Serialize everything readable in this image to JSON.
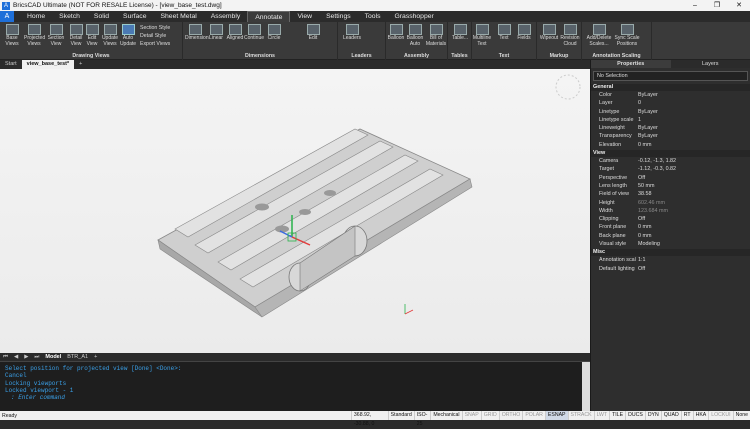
{
  "title": "BricsCAD Ultimate (NOT FOR RESALE License) - [view_base_test.dwg]",
  "menu": [
    "Home",
    "Sketch",
    "Solid",
    "Surface",
    "Sheet Metal",
    "Assembly",
    "Annotate",
    "View",
    "Settings",
    "Tools",
    "Grasshopper"
  ],
  "active_menu": "Annotate",
  "ribbon": {
    "drawing_views": {
      "title": "Drawing Views",
      "buttons": [
        "Base Views",
        "Projected Views",
        "Section View",
        "Detail View",
        "Edit View",
        "Update Views",
        "Auto Update"
      ],
      "small": [
        "Section Style",
        "Detail Style",
        "Export Views"
      ]
    },
    "dimensions": {
      "title": "Dimensions",
      "buttons": [
        "Dimension",
        "Linear",
        "Aligned",
        "Continue",
        "Circle",
        "Edit"
      ]
    },
    "leaders": {
      "title": "Leaders",
      "buttons": [
        "Leaders"
      ]
    },
    "assembly": {
      "title": "Assembly",
      "buttons": [
        "Balloon",
        "Balloon Auto",
        "Bill of Materials"
      ]
    },
    "tables": {
      "title": "Tables",
      "buttons": [
        "Table..."
      ]
    },
    "text": {
      "title": "Text",
      "buttons": [
        "Multiline Text",
        "Text",
        "Fields"
      ]
    },
    "markup": {
      "title": "Markup",
      "buttons": [
        "Wipeout",
        "Revision Cloud"
      ]
    },
    "annotation_scaling": {
      "title": "Annotation Scaling",
      "buttons": [
        "Add/Delete Scales...",
        "Sync Scale Positions"
      ]
    }
  },
  "doc_tabs": [
    "Start",
    "view_base_test*"
  ],
  "layout_tabs": {
    "model": "Model",
    "layout": "BTR_A1"
  },
  "command_lines": [
    "Select position for projected view [Done] <Done>:",
    "Cancel",
    "Locking viewports",
    "Locked viewport - 1"
  ],
  "command_prompt": ": Enter command",
  "status": {
    "ready": "Ready",
    "coords": "368.92, -30.88, 0",
    "items": [
      "Standard",
      "ISO-25",
      "Mechanical",
      "SNAP",
      "GRID",
      "ORTHO",
      "POLAR",
      "ESNAP",
      "STRACK",
      "LWT",
      "TILE",
      "DUCS",
      "DYN",
      "QUAD",
      "RT",
      "HKA",
      "LOCKUI",
      "None"
    ]
  },
  "panel": {
    "tabs": [
      "Properties",
      "Layers"
    ],
    "selection": "No Selection",
    "sections": [
      {
        "name": "General",
        "rows": [
          [
            "Color",
            "ByLayer"
          ],
          [
            "Layer",
            "0"
          ],
          [
            "Linetype",
            "ByLayer"
          ],
          [
            "Linetype scale",
            "1"
          ],
          [
            "Lineweight",
            "ByLayer"
          ],
          [
            "Transparency",
            "ByLayer"
          ],
          [
            "Elevation",
            "0 mm"
          ]
        ]
      },
      {
        "name": "View",
        "rows": [
          [
            "Camera",
            "-0.12, -1.3, 1.82"
          ],
          [
            "Target",
            "-1.12, -0.3, 0.82"
          ],
          [
            "Perspective",
            "Off"
          ],
          [
            "Lens length",
            "50 mm"
          ],
          [
            "Field of view",
            "38.58"
          ],
          [
            "Height",
            "602.46 mm"
          ],
          [
            "Width",
            "123.684 mm"
          ],
          [
            "Clipping",
            "Off"
          ],
          [
            "Front plane",
            "0 mm"
          ],
          [
            "Back plane",
            "0 mm"
          ],
          [
            "Visual style",
            "Modeling"
          ]
        ]
      },
      {
        "name": "Misc",
        "rows": [
          [
            "Annotation scale",
            "1:1"
          ],
          [
            "Default lighting",
            "Off"
          ]
        ]
      }
    ]
  },
  "colors": {
    "accent": "#1e6fd9",
    "command_text": "#3aa0e8",
    "viewport_bg": "#f2f2f2"
  }
}
